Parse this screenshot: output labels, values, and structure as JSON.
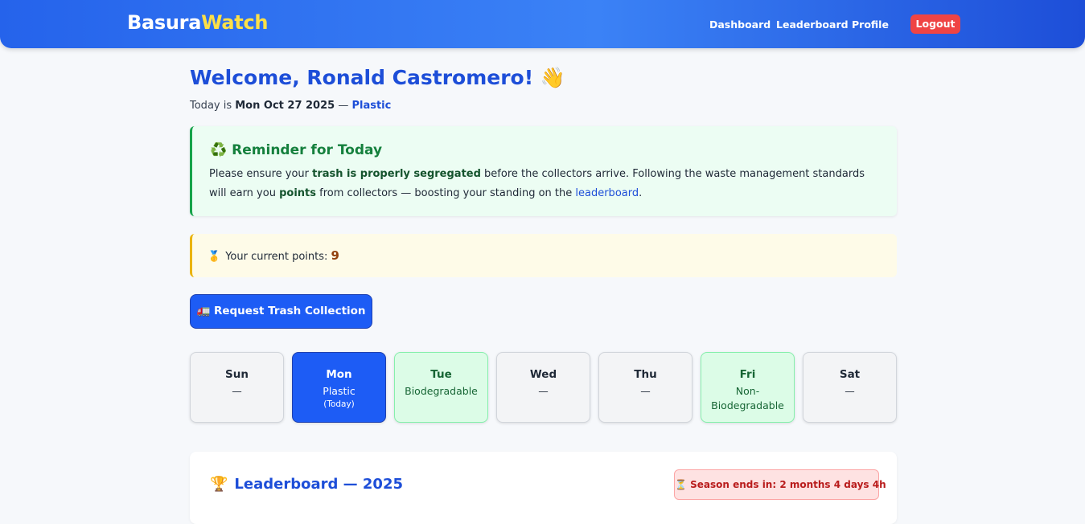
{
  "brand": {
    "part1": "Basura",
    "part2": "Watch"
  },
  "nav": {
    "dashboard": "Dashboard",
    "leaderboard": "Leaderboard",
    "profile": "Profile",
    "logout": "Logout"
  },
  "welcome": {
    "text": "Welcome, Ronald Castromero!",
    "emoji": "👋"
  },
  "today": {
    "prefix": "Today is ",
    "date": "Mon Oct 27 2025",
    "sep": " — ",
    "type": "Plastic"
  },
  "reminder": {
    "icon": "♻️",
    "title": "Reminder for Today",
    "t1": "Please ensure your ",
    "b1": "trash is properly segregated",
    "t2": " before the collectors arrive. Following the waste management standards will earn you ",
    "b2": "points",
    "t3": " from collectors — boosting your standing on the ",
    "link": "leaderboard",
    "t4": "."
  },
  "points": {
    "icon": "🥇",
    "label": "Your current points: ",
    "value": "9"
  },
  "request_button": "🚛 Request Trash Collection",
  "schedule": [
    {
      "day": "Sun",
      "type": "—",
      "note": ""
    },
    {
      "day": "Mon",
      "type": "Plastic",
      "note": "(Today)"
    },
    {
      "day": "Tue",
      "type": "Biodegradable",
      "note": ""
    },
    {
      "day": "Wed",
      "type": "—",
      "note": ""
    },
    {
      "day": "Thu",
      "type": "—",
      "note": ""
    },
    {
      "day": "Fri",
      "type": "Non-Biodegradable",
      "note": ""
    },
    {
      "day": "Sat",
      "type": "—",
      "note": ""
    }
  ],
  "leaderboard": {
    "icon": "🏆",
    "title": "Leaderboard — 2025",
    "season": "⏳ Season ends in: 2 months 4 days 4h"
  },
  "colors": {
    "primary": "#1d5cf5",
    "accent": "#fde047",
    "success": "#16a34a",
    "danger": "#ef4444",
    "warning": "#eab308"
  }
}
